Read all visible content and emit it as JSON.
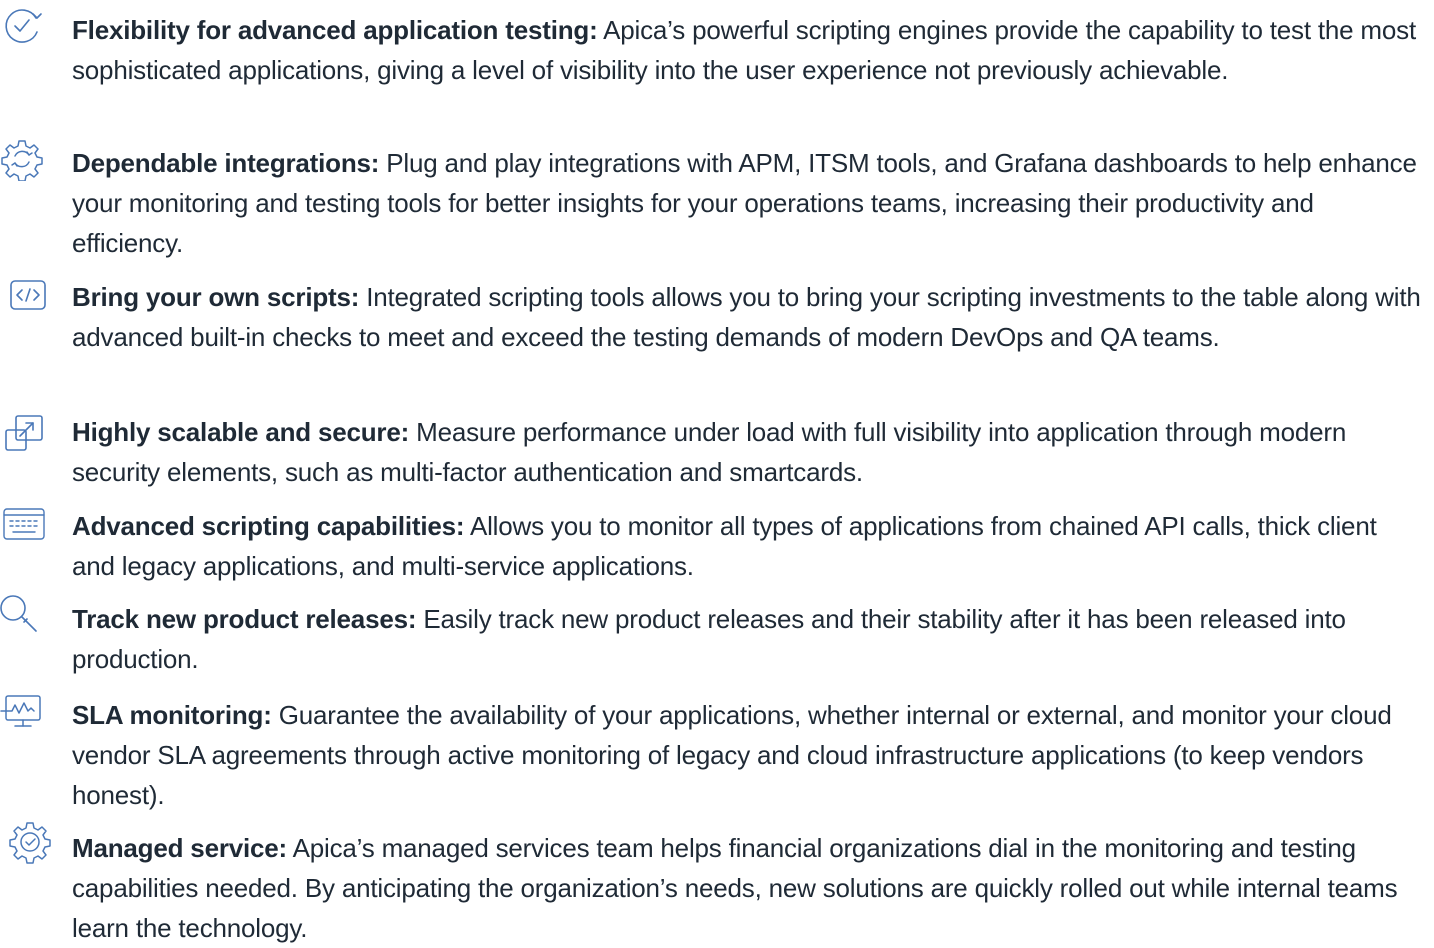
{
  "colors": {
    "text": "#1f2a36",
    "icon": "#4a78b8"
  },
  "features": [
    {
      "icon": "check-circle-arrows-icon",
      "title": "Flexibility for advanced application testing:",
      "body": "Apica’s powerful scripting engines provide the capability to test the most sophisticated applications, giving a level of visibility into the user experience not previously achievable."
    },
    {
      "icon": "gear-sync-icon",
      "title": "Dependable integrations:",
      "body": "Plug and play integrations with APM, ITSM tools, and Grafana dashboards to help enhance your monitoring and testing tools for better insights for your operations teams, increasing their productivity and efficiency."
    },
    {
      "icon": "code-window-icon",
      "title": "Bring your own scripts:",
      "body": "Integrated scripting tools allows you to bring your scripting investments to the table along with advanced built-in checks to meet and exceed the testing demands of modern DevOps and QA teams."
    },
    {
      "icon": "scale-expand-icon",
      "title": "Highly scalable and secure:",
      "body": "Measure performance under load with full visibility into application through modern security elements, such as multi-factor authentication and smartcards."
    },
    {
      "icon": "keyboard-icon",
      "title": "Advanced scripting capabilities:",
      "body": "Allows you to monitor all types of applications from chained API calls, thick client and legacy applications, and multi-service applications."
    },
    {
      "icon": "magnifier-icon",
      "title": "Track new product releases:",
      "body": "Easily track new product releases and their stability after it has been released into production."
    },
    {
      "icon": "monitor-pulse-icon",
      "title": "SLA monitoring:",
      "body": "Guarantee the availability of your applications, whether internal or external, and monitor your cloud vendor SLA agreements through active monitoring of legacy and cloud infrastructure applications (to keep vendors honest)."
    },
    {
      "icon": "gear-check-icon",
      "title": "Managed service:",
      "body": "Apica’s managed services team helps financial organizations dial in the monitoring and testing capabilities needed. By anticipating the organization’s needs, new solutions are quickly rolled out while internal teams learn the technology."
    }
  ]
}
